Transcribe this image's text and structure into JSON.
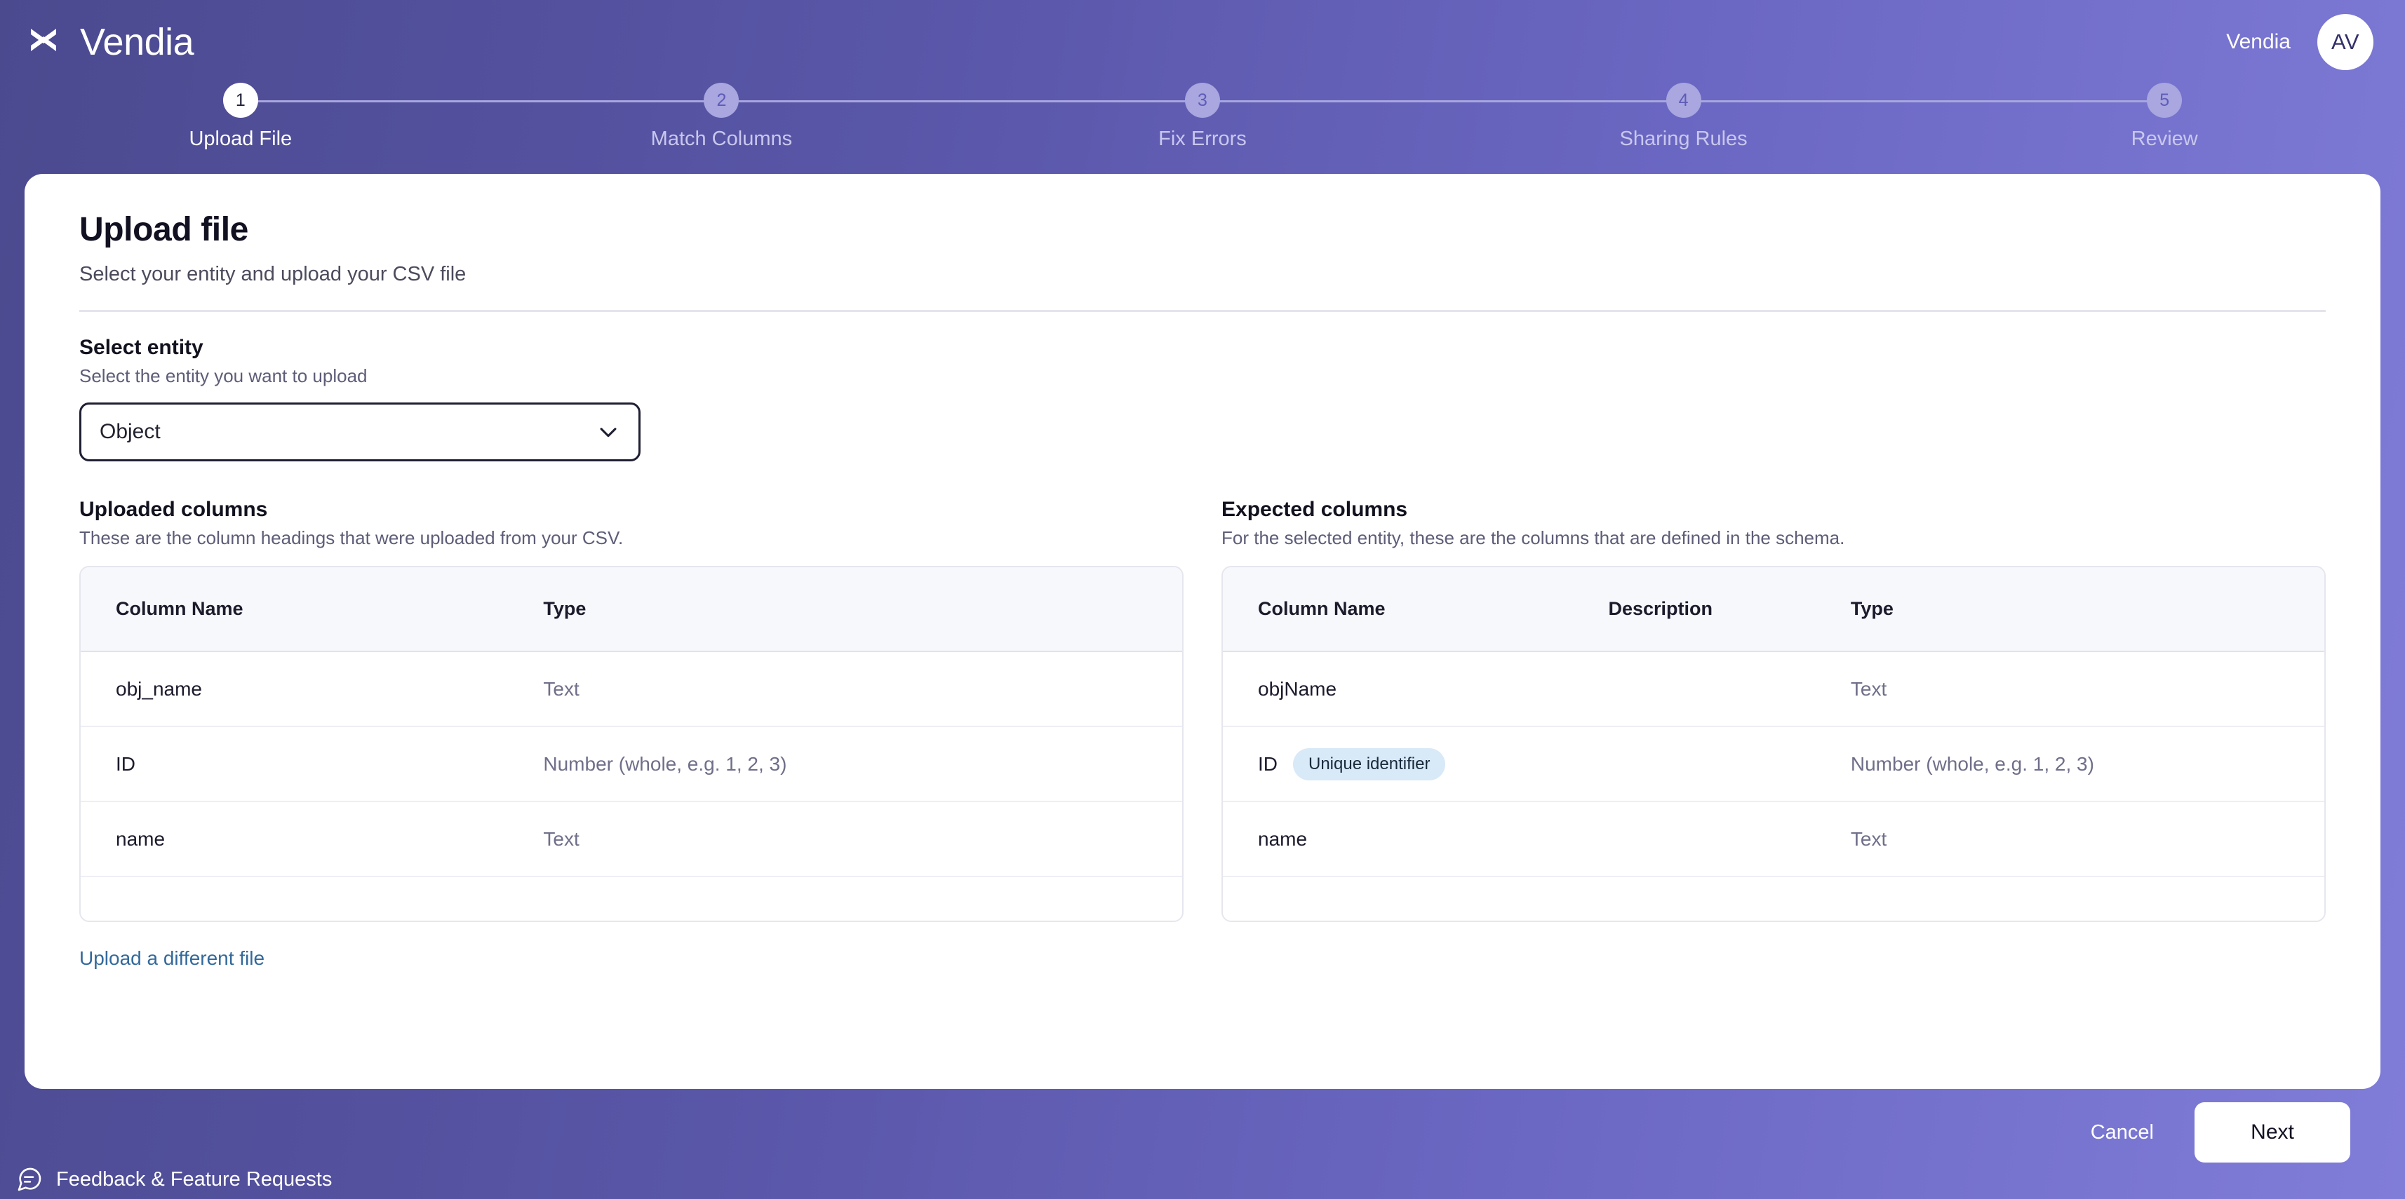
{
  "header": {
    "brand_name": "Vendia",
    "logo_icon": "vendia-weave-logo",
    "org_name": "Vendia",
    "avatar_initials": "AV"
  },
  "stepper": {
    "active_step": 1,
    "steps": [
      {
        "number": "1",
        "label": "Upload File"
      },
      {
        "number": "2",
        "label": "Match Columns"
      },
      {
        "number": "3",
        "label": "Fix Errors"
      },
      {
        "number": "4",
        "label": "Sharing Rules"
      },
      {
        "number": "5",
        "label": "Review"
      }
    ]
  },
  "card": {
    "title": "Upload file",
    "subtitle": "Select your entity and upload your CSV file"
  },
  "entity_select": {
    "label": "Select entity",
    "hint": "Select the entity you want to upload",
    "value": "Object",
    "chevron_icon": "chevron-down-icon"
  },
  "uploaded_columns": {
    "title": "Uploaded columns",
    "hint": "These are the column headings that were uploaded from your CSV.",
    "headers": [
      "Column Name",
      "Type"
    ],
    "rows": [
      {
        "name": "obj_name",
        "type": "Text"
      },
      {
        "name": "ID",
        "type": "Number (whole, e.g. 1, 2, 3)"
      },
      {
        "name": "name",
        "type": "Text"
      }
    ]
  },
  "expected_columns": {
    "title": "Expected columns",
    "hint": "For the selected entity, these are the columns that are defined in the schema.",
    "headers": [
      "Column Name",
      "Description",
      "Type"
    ],
    "rows": [
      {
        "name": "objName",
        "badge": "",
        "description": "",
        "type": "Text"
      },
      {
        "name": "ID",
        "badge": "Unique identifier",
        "description": "",
        "type": "Number (whole, e.g. 1, 2, 3)"
      },
      {
        "name": "name",
        "badge": "",
        "description": "",
        "type": "Text"
      }
    ]
  },
  "links": {
    "upload_different_file": "Upload a different file"
  },
  "footer": {
    "cancel_label": "Cancel",
    "next_label": "Next",
    "feedback_label": "Feedback & Feature Requests",
    "feedback_icon": "speech-bubble-icon"
  },
  "colors": {
    "brand_purple_dark": "#4b4a8f",
    "brand_purple_light": "#807dd8",
    "badge_blue_bg": "#d8e9f8",
    "link_blue": "#33699b",
    "step_inactive": "#a9a6e0"
  }
}
